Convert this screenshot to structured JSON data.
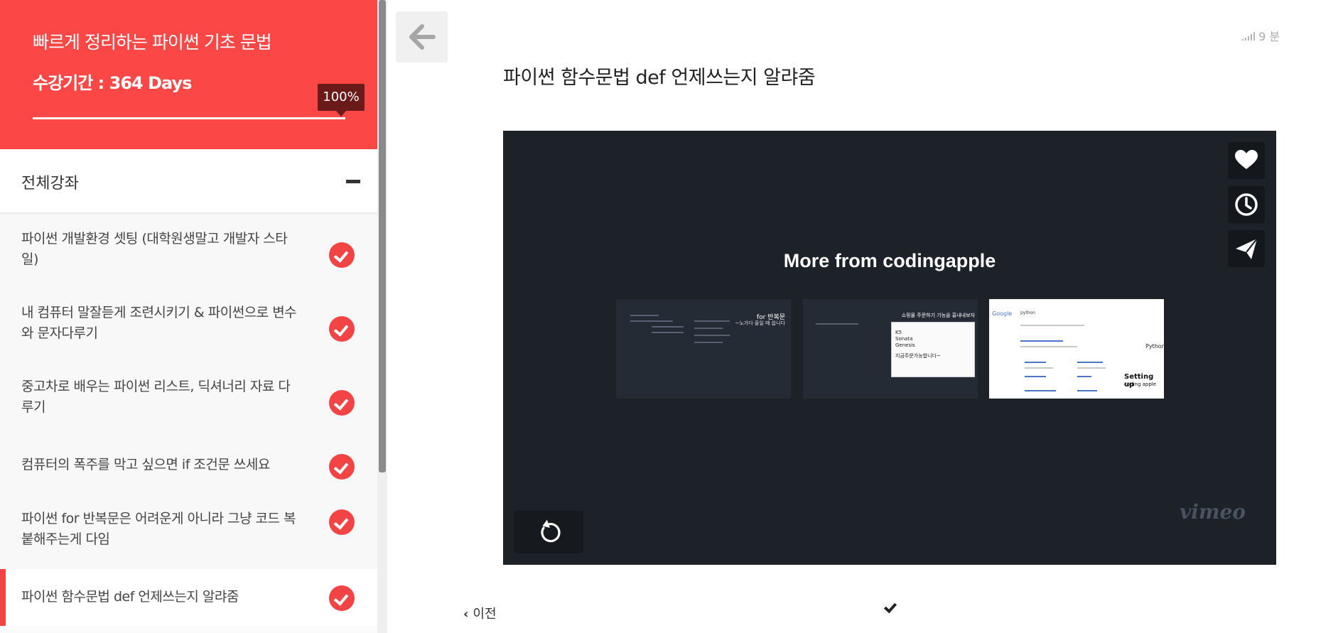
{
  "course": {
    "title": "빠르게 정리하는 파이썬 기초 문법",
    "period": "수강기간 : 364 Days",
    "progress_label": "100%",
    "progress_value": 1.0
  },
  "sidebar": {
    "section_label": "전체강좌",
    "lessons": [
      {
        "title_line1": "파이썬 개발환경 셋팅 (대학원생말고 개발자 스타",
        "title_line2": "일)",
        "completed": true
      },
      {
        "title_line1": "내 컴퓨터 말잘듣게 조련시키기 & 파이썬으로 변수",
        "title_line2": "와 문자다루기",
        "completed": true
      },
      {
        "title_line1": "중고차로 배우는 파이썬 리스트, 딕셔너리 자료 다",
        "title_line2": "루기",
        "completed": true
      },
      {
        "title_line1": "컴퓨터의 폭주를 막고 싶으면 if 조건문 쓰세요",
        "title_line2": "",
        "completed": true
      },
      {
        "title_line1": "파이썬 for 반복문은 어려운게 아니라 그냥 코드 복",
        "title_line2": "붙해주는게 다임",
        "completed": true
      },
      {
        "title_line1": "파이썬 함수문법 def 언제쓰는지 알랴줌",
        "title_line2": "",
        "completed": true,
        "active": true
      }
    ]
  },
  "main": {
    "duration": "9 분",
    "lesson_title": "파이썬 함수문법 def 언제쓰는지 알랴줌",
    "prev_label": "이전"
  },
  "video": {
    "more_from": "More from codingapple",
    "brand": "vimeo",
    "thumbnails": [
      {
        "caption1": "for 반복문",
        "caption2": "~노가다 줄일 때 씁니다"
      },
      {
        "caption1": "쇼핑몰 주문하기 기능을 흉내내보자",
        "popup_lines": [
          "K5",
          "Sonata",
          "Genesis",
          "",
          "지금주문가능합니다~"
        ]
      },
      {
        "site": "Google",
        "query": "python",
        "heading": "Python",
        "overlay1": "Setting up",
        "overlay2": "coding apple"
      }
    ]
  },
  "colors": {
    "accent": "#fc4747",
    "video_bg": "#1c2228"
  }
}
